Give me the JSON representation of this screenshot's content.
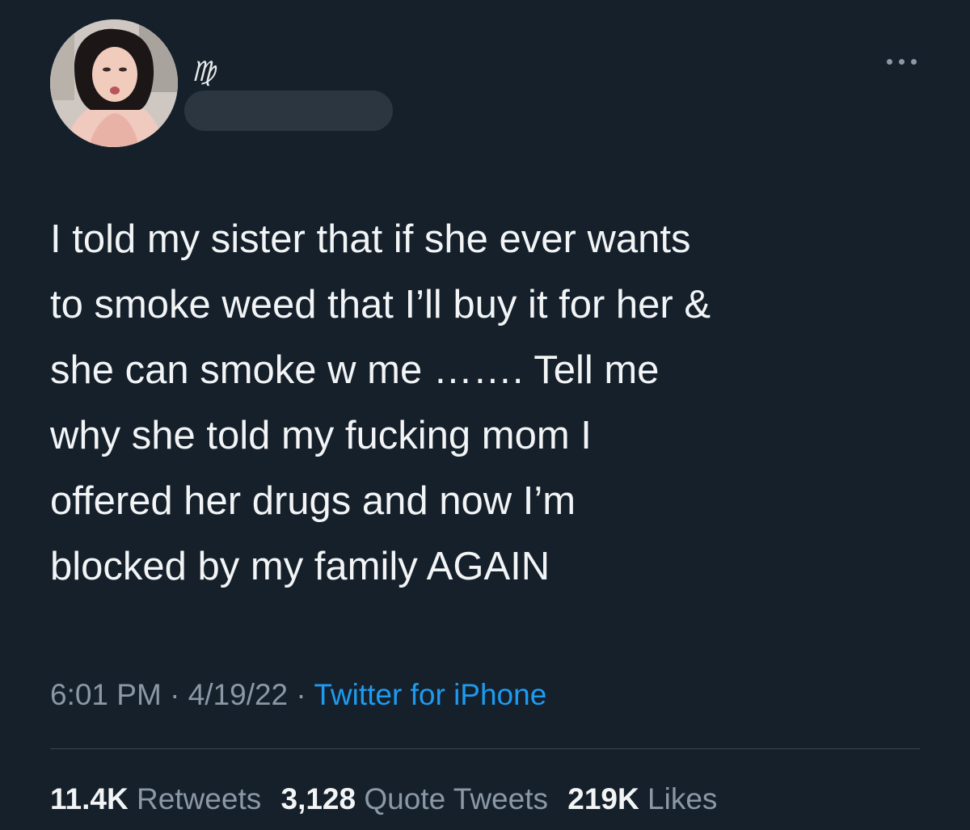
{
  "tweet": {
    "author": {
      "display_name": "♍︎",
      "avatar_icon": "profile-photo"
    },
    "text": "I told my sister that if she ever wants\nto smoke weed that I’ll buy it for her &\nshe can smoke w me ……. Tell me\nwhy she told my fucking mom I\noffered her drugs and now I’m\nblocked by my family AGAIN",
    "time": "6:01 PM",
    "separator": "·",
    "date": "4/19/22",
    "source": "Twitter for iPhone",
    "stats": {
      "retweets_count": "11.4K",
      "retweets_label": "Retweets",
      "quotes_count": "3,128",
      "quotes_label": "Quote Tweets",
      "likes_count": "219K",
      "likes_label": "Likes"
    }
  },
  "colors": {
    "background": "#15202b",
    "text": "#f2f4f5",
    "secondary": "#8b98a5",
    "link": "#1d9bf0"
  }
}
